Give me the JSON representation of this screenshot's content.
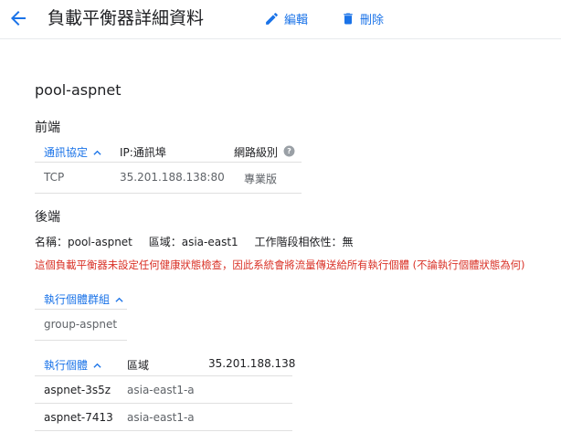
{
  "header": {
    "title": "負載平衡器詳細資料",
    "back_icon": "arrow-back-icon",
    "edit_label": "編輯",
    "edit_icon": "pencil-icon",
    "delete_label": "刪除",
    "delete_icon": "trash-icon",
    "accent_color": "#1a73e8"
  },
  "lb_name": "pool-aspnet",
  "frontend": {
    "title": "前端",
    "columns": [
      "通訊協定",
      "IP:通訊埠",
      "網路級別"
    ],
    "sorted_column": "通訊協定",
    "help_icon": "help-icon",
    "rows": [
      {
        "protocol": "TCP",
        "ip_port": "35.201.188.138:80",
        "tier": "專業版"
      }
    ]
  },
  "backend": {
    "title": "後端",
    "name_text": "名稱：pool-aspnet",
    "region_text": "區域：asia-east1",
    "affinity_text": "工作階段相依性：無",
    "warning": "這個負載平衡器未設定任何健康狀態檢查，因此系統會將流量傳送給所有執行個體 (不論執行個體狀態為何)",
    "warning_color": "#d93025",
    "instance_groups": {
      "column": "執行個體群組",
      "rows": [
        "group-aspnet"
      ]
    },
    "instances": {
      "columns": [
        "執行個體",
        "區域",
        "35.201.188.138"
      ],
      "sorted_column": "執行個體",
      "rows": [
        {
          "name": "aspnet-3s5z",
          "zone": "asia-east1-a"
        },
        {
          "name": "aspnet-7413",
          "zone": "asia-east1-a"
        }
      ]
    }
  }
}
